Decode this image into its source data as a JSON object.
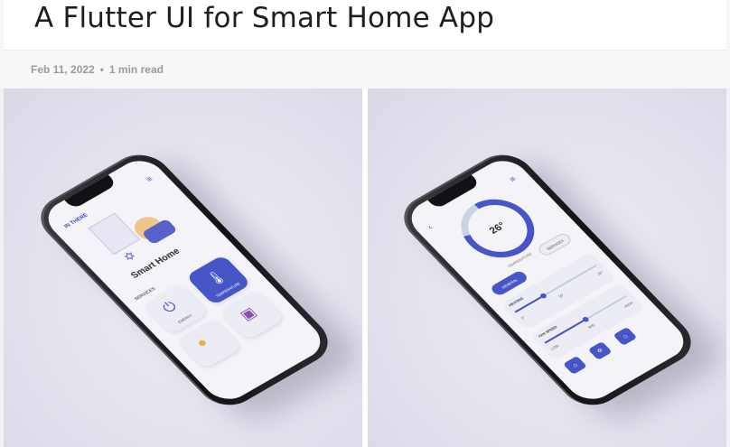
{
  "post": {
    "title": "A Flutter UI for Smart Home App",
    "date": "Feb 11, 2022",
    "separator": "•",
    "read_time": "1 min read"
  },
  "mockup_left": {
    "tag": "IN THERE",
    "menu_icon": "menu-icon",
    "screen_title": "Smart Home",
    "section_label": "SERVICES",
    "cards": [
      {
        "label": "ENERGY",
        "icon": "power-plug-icon"
      },
      {
        "label": "TEMPERATURE",
        "icon": "thermometer-icon",
        "active": true
      },
      {
        "label": "",
        "icon": "bulb-icon"
      },
      {
        "label": "",
        "icon": "tv-icon"
      }
    ]
  },
  "mockup_right": {
    "temperature": "26°",
    "dial_label": "TEMPERATURE",
    "dial_fraction": 0.8,
    "pill_active": "GENERAL",
    "pill_inactive": "SERVICES",
    "heating": {
      "label": "HEATING",
      "value_fraction": 0.35,
      "ticks": [
        "0°",
        "15°",
        "30°"
      ]
    },
    "fan": {
      "label": "FAN SPEED",
      "value_fraction": 0.5,
      "ticks": [
        "LOW",
        "MID",
        "HIGH"
      ]
    }
  },
  "colors": {
    "accent": "#4756c6",
    "title_text": "#1e1e22",
    "meta_text": "#9a9aa2",
    "panel_bg": "#e3e3ee"
  }
}
